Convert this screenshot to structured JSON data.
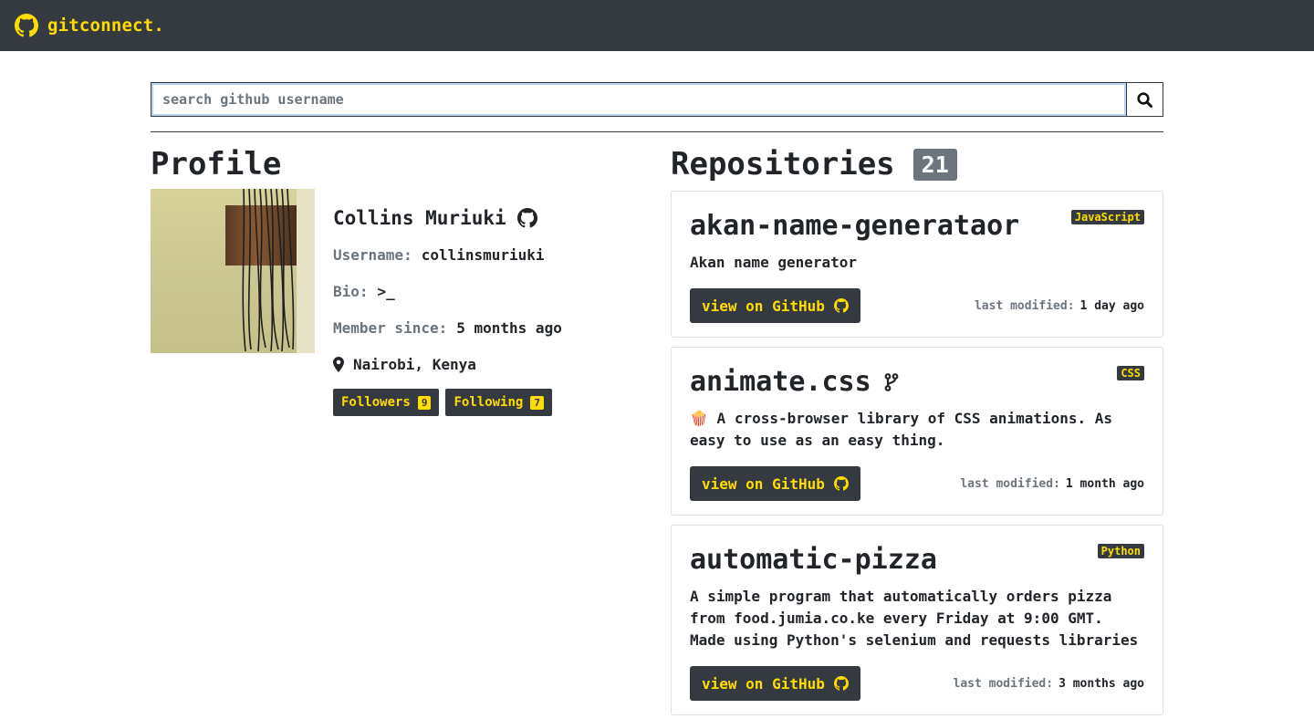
{
  "navbar": {
    "brand": "gitconnect."
  },
  "search": {
    "placeholder": "search github username",
    "value": ""
  },
  "profile": {
    "title": "Profile",
    "name": "Collins Muriuki",
    "username_label": "Username:",
    "username": "collinsmuriuki",
    "bio_label": "Bio:",
    "bio": ">_",
    "member_label": "Member since:",
    "member_since": "5 months ago",
    "location": "Nairobi, Kenya",
    "followers_label": "Followers",
    "followers_count": "9",
    "following_label": "Following",
    "following_count": "7"
  },
  "repositories": {
    "title": "Repositories",
    "count": "21",
    "items": [
      {
        "name": "akan-name-generataor",
        "language": "JavaScript",
        "description": "Akan name generator",
        "button": "view on GitHub",
        "modified_label": "last modified:",
        "modified": "1 day ago"
      },
      {
        "name": "animate.css",
        "language": "CSS",
        "description": "🍿 A cross-browser library of CSS animations. As easy to use as an easy thing.",
        "button": "view on GitHub",
        "modified_label": "last modified:",
        "modified": "1 month ago"
      },
      {
        "name": "automatic-pizza",
        "language": "Python",
        "description": "A simple program that automatically orders pizza from food.jumia.co.ke every Friday at 9:00 GMT. Made using Python's selenium and requests libraries",
        "button": "view on GitHub",
        "modified_label": "last modified:",
        "modified": "3 months ago"
      }
    ]
  },
  "colors": {
    "navbar": "#343a40",
    "accent": "#ffdd00",
    "muted": "#6c757d"
  }
}
